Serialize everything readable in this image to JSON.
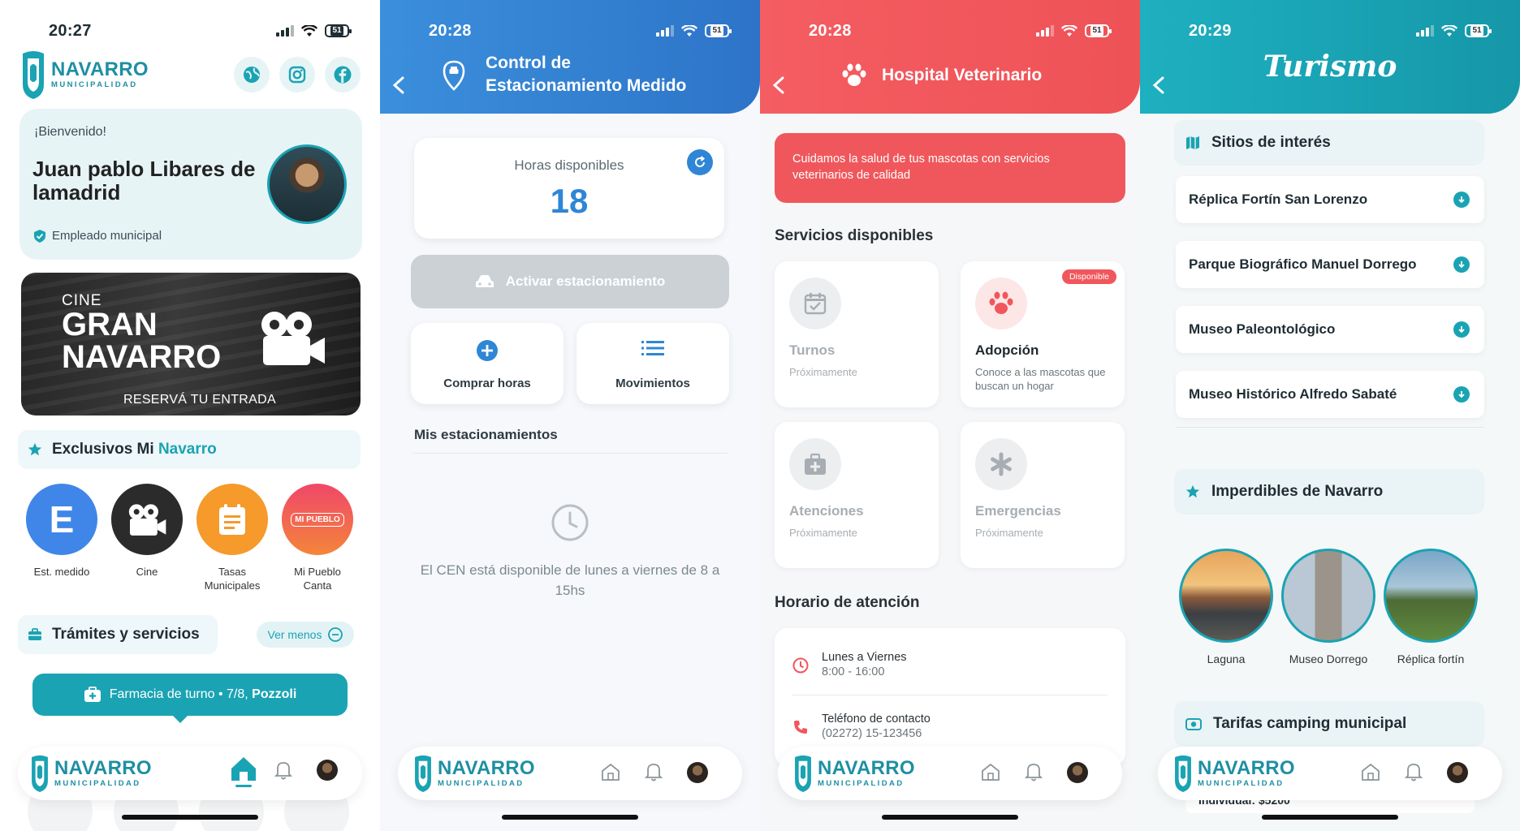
{
  "screens": {
    "inicio": {
      "time": "20:27",
      "battery": "51",
      "logo": {
        "name": "NAVARRO",
        "sub": "MUNICIPALIDAD"
      },
      "social": [
        "globe-icon",
        "instagram-icon",
        "facebook-icon"
      ],
      "welcome": {
        "greeting": "¡Bienvenido!",
        "name": "Juan pablo Libares de lamadrid",
        "role": "Empleado municipal"
      },
      "banner": {
        "line1": "CINE",
        "line2": "GRAN",
        "line3": "NAVARRO",
        "cta": "RESERVÁ TU ENTRADA"
      },
      "exclusivos": {
        "title_prefix": "Exclusivos Mi ",
        "title_highlight": "Navarro"
      },
      "quick": [
        {
          "label": "Est. medido",
          "glyph": "E",
          "color": "#3f86e8"
        },
        {
          "label": "Cine",
          "glyph": "",
          "color": "#2b2b2b"
        },
        {
          "label": "Tasas Municipales",
          "glyph": "",
          "color": "#f59a2b"
        },
        {
          "label": "Mi Pueblo Canta",
          "glyph": "MI PUEBLO",
          "color": "#f0476a"
        }
      ],
      "tramites": {
        "title": "Trámites y servicios",
        "toggle": "Ver menos"
      },
      "farmacia": {
        "prefix": "Farmacia de turno • 7/8,",
        "name": "Pozzoli"
      }
    },
    "estacionamiento": {
      "time": "20:28",
      "battery": "51",
      "title_l1": "Control de",
      "title_l2": "Estacionamiento Medido",
      "hours_label": "Horas disponibles",
      "hours_value": "18",
      "activate": "Activar estacionamiento",
      "buy": "Comprar horas",
      "moves": "Movimientos",
      "mine_title": "Mis estacionamientos",
      "info": "El CEN está disponible de lunes a viernes de 8 a 15hs"
    },
    "veterinario": {
      "time": "20:28",
      "battery": "51",
      "title": "Hospital Veterinario",
      "banner": "Cuidamos la salud de tus mascotas con servicios veterinarios de calidad",
      "services_title": "Servicios disponibles",
      "services": [
        {
          "title": "Turnos",
          "subtitle": "Próximamente",
          "icon": "calendar-check-icon",
          "available": false
        },
        {
          "title": "Adopción",
          "subtitle": "Conoce a las mascotas que buscan un hogar",
          "icon": "paw-icon",
          "available": true,
          "badge": "Disponible"
        },
        {
          "title": "Atenciones",
          "subtitle": "Próximamente",
          "icon": "medkit-icon",
          "available": false
        },
        {
          "title": "Emergencias",
          "subtitle": "Próximamente",
          "icon": "asterisk-icon",
          "available": false
        }
      ],
      "schedule_title": "Horario de atención",
      "schedule": [
        {
          "label": "Lunes a Viernes",
          "value": "8:00 - 16:00"
        },
        {
          "label": "Teléfono de contacto",
          "value": "(02272) 15-123456"
        }
      ]
    },
    "turismo": {
      "time": "20:29",
      "battery": "51",
      "title": "Turismo",
      "sites_title": "Sitios de interés",
      "sites": [
        "Réplica Fortín San Lorenzo",
        "Parque Biográfico Manuel Dorrego",
        "Museo Paleontológico",
        "Museo Histórico Alfredo Sabaté"
      ],
      "must_title": "Imperdibles de Navarro",
      "must": [
        "Laguna",
        "Museo Dorrego",
        "Réplica fortín"
      ],
      "camping_title": "Tarifas camping municipal",
      "camping_peek": "Individual: $5200"
    }
  },
  "colors": {
    "teal": "#1aa3b3",
    "blue": "#2f86d6",
    "red": "#f0575c"
  }
}
